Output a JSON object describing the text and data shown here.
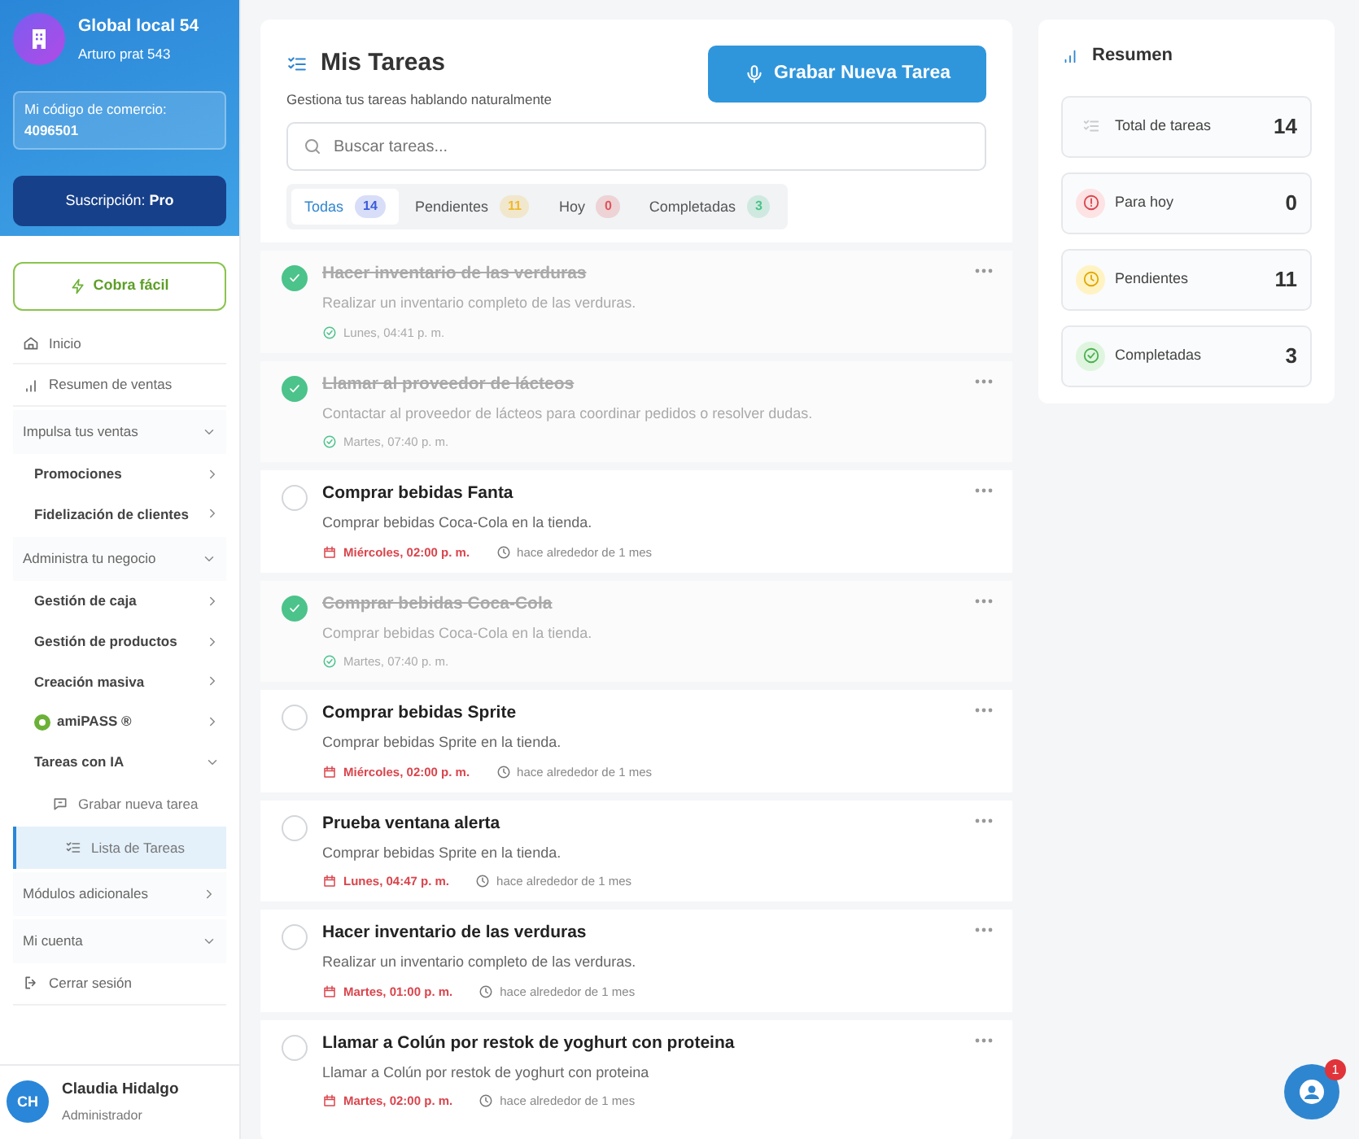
{
  "sidebar": {
    "store_name": "Global local 54",
    "address": "Arturo prat 543",
    "code_label": "Mi código de comercio:",
    "code_value": "4096501",
    "subscription": "Suscripción: **Pro**",
    "cobra_button": "Cobra fácil",
    "nav": [
      {
        "kind": "home",
        "label": "Inicio"
      },
      {
        "kind": "sales",
        "label": "Resumen de ventas"
      },
      {
        "kind": "group",
        "label": "Impulsa tus ventas",
        "expanded": true,
        "children": [
          {
            "kind": "sub",
            "label": "Promociones",
            "expanded": false
          },
          {
            "kind": "sub",
            "label": "Fidelización de clientes",
            "expanded": false
          }
        ]
      },
      {
        "kind": "group",
        "label": "Administra tu negocio",
        "expanded": true,
        "children": [
          {
            "kind": "sub",
            "label": "Gestión de caja",
            "expanded": false
          },
          {
            "kind": "sub",
            "label": "Gestión de productos",
            "expanded": false
          },
          {
            "kind": "sub",
            "label": "Creación masiva",
            "expanded": false
          },
          {
            "kind": "partner",
            "label": "amiPASS ®",
            "expanded": false
          },
          {
            "kind": "sub",
            "label": "Tareas con IA",
            "expanded": true,
            "children": [
              {
                "kind": "record",
                "label": "Grabar nueva tarea",
                "selected": false
              },
              {
                "kind": "tasklist",
                "label": "Lista de Tareas",
                "selected": true
              }
            ]
          }
        ]
      },
      {
        "kind": "group",
        "label": "Módulos adicionales",
        "expanded": false
      },
      {
        "kind": "group",
        "label": "Mi cuenta",
        "expanded": true,
        "children": [
          {
            "kind": "logout",
            "label": "Cerrar sesión"
          }
        ]
      }
    ],
    "user": {
      "initials": "CH",
      "name": "Claudia Hidalgo",
      "role": "Administrador"
    }
  },
  "main": {
    "title": "Mis Tareas",
    "subtitle": "Gestiona tus tareas hablando naturalmente",
    "record_button": "Grabar Nueva Tarea",
    "search": {
      "placeholder": "Buscar tareas..."
    },
    "tabs": [
      {
        "label": "Todas",
        "count": "14",
        "color": "#3b5bdb",
        "selected": true
      },
      {
        "label": "Pendientes",
        "count": "11",
        "color": "#f1b92e",
        "selected": false
      },
      {
        "label": "Hoy",
        "count": "0",
        "color": "#e0555b",
        "selected": false
      },
      {
        "label": "Completadas",
        "count": "3",
        "color": "#4cc38a",
        "selected": false
      }
    ],
    "tasks": [
      {
        "title": "Hacer inventario de las verduras",
        "description": "Realizar un inventario completo de las verduras.",
        "done": true,
        "date": "Lunes, 04:41 p. m."
      },
      {
        "title": "Llamar al proveedor de lácteos",
        "description": "Contactar al proveedor de lácteos para coordinar pedidos o resolver dudas.",
        "done": true,
        "date": "Martes, 07:40 p. m."
      },
      {
        "title": "Comprar bebidas Fanta",
        "description": "Comprar bebidas Coca-Cola en la tienda.",
        "done": false,
        "date": "Miércoles, 02:00 p. m.",
        "ago": "hace alrededor de 1 mes"
      },
      {
        "title": "Comprar bebidas Coca-Cola",
        "description": "Comprar bebidas Coca-Cola en la tienda.",
        "done": true,
        "date": "Martes, 07:40 p. m."
      },
      {
        "title": "Comprar bebidas Sprite",
        "description": "Comprar bebidas Sprite en la tienda.",
        "done": false,
        "date": "Miércoles, 02:00 p. m.",
        "ago": "hace alrededor de 1 mes"
      },
      {
        "title": "Prueba ventana alerta",
        "description": "Comprar bebidas Sprite en la tienda.",
        "done": false,
        "date": "Lunes, 04:47 p. m.",
        "ago": "hace alrededor de 1 mes"
      },
      {
        "title": "Hacer inventario de las verduras",
        "description": "Realizar un inventario completo de las verduras.",
        "done": false,
        "date": "Martes, 01:00 p. m.",
        "ago": "hace alrededor de 1 mes"
      },
      {
        "title": "Llamar a Colún por restok de yoghurt con proteina",
        "description": "Llamar a Colún por restok de yoghurt con proteina",
        "done": false,
        "date": "Martes, 02:00 p. m.",
        "ago": "hace alrededor de 1 mes"
      }
    ]
  },
  "summary": {
    "title": "Resumen",
    "stats": [
      {
        "kind": "total",
        "label": "Total de tareas",
        "value": "14"
      },
      {
        "kind": "today",
        "label": "Para hoy",
        "value": "0"
      },
      {
        "kind": "pending",
        "label": "Pendientes",
        "value": "11"
      },
      {
        "kind": "done",
        "label": "Completadas",
        "value": "3"
      }
    ]
  },
  "chat_button": {
    "badge": "1"
  }
}
